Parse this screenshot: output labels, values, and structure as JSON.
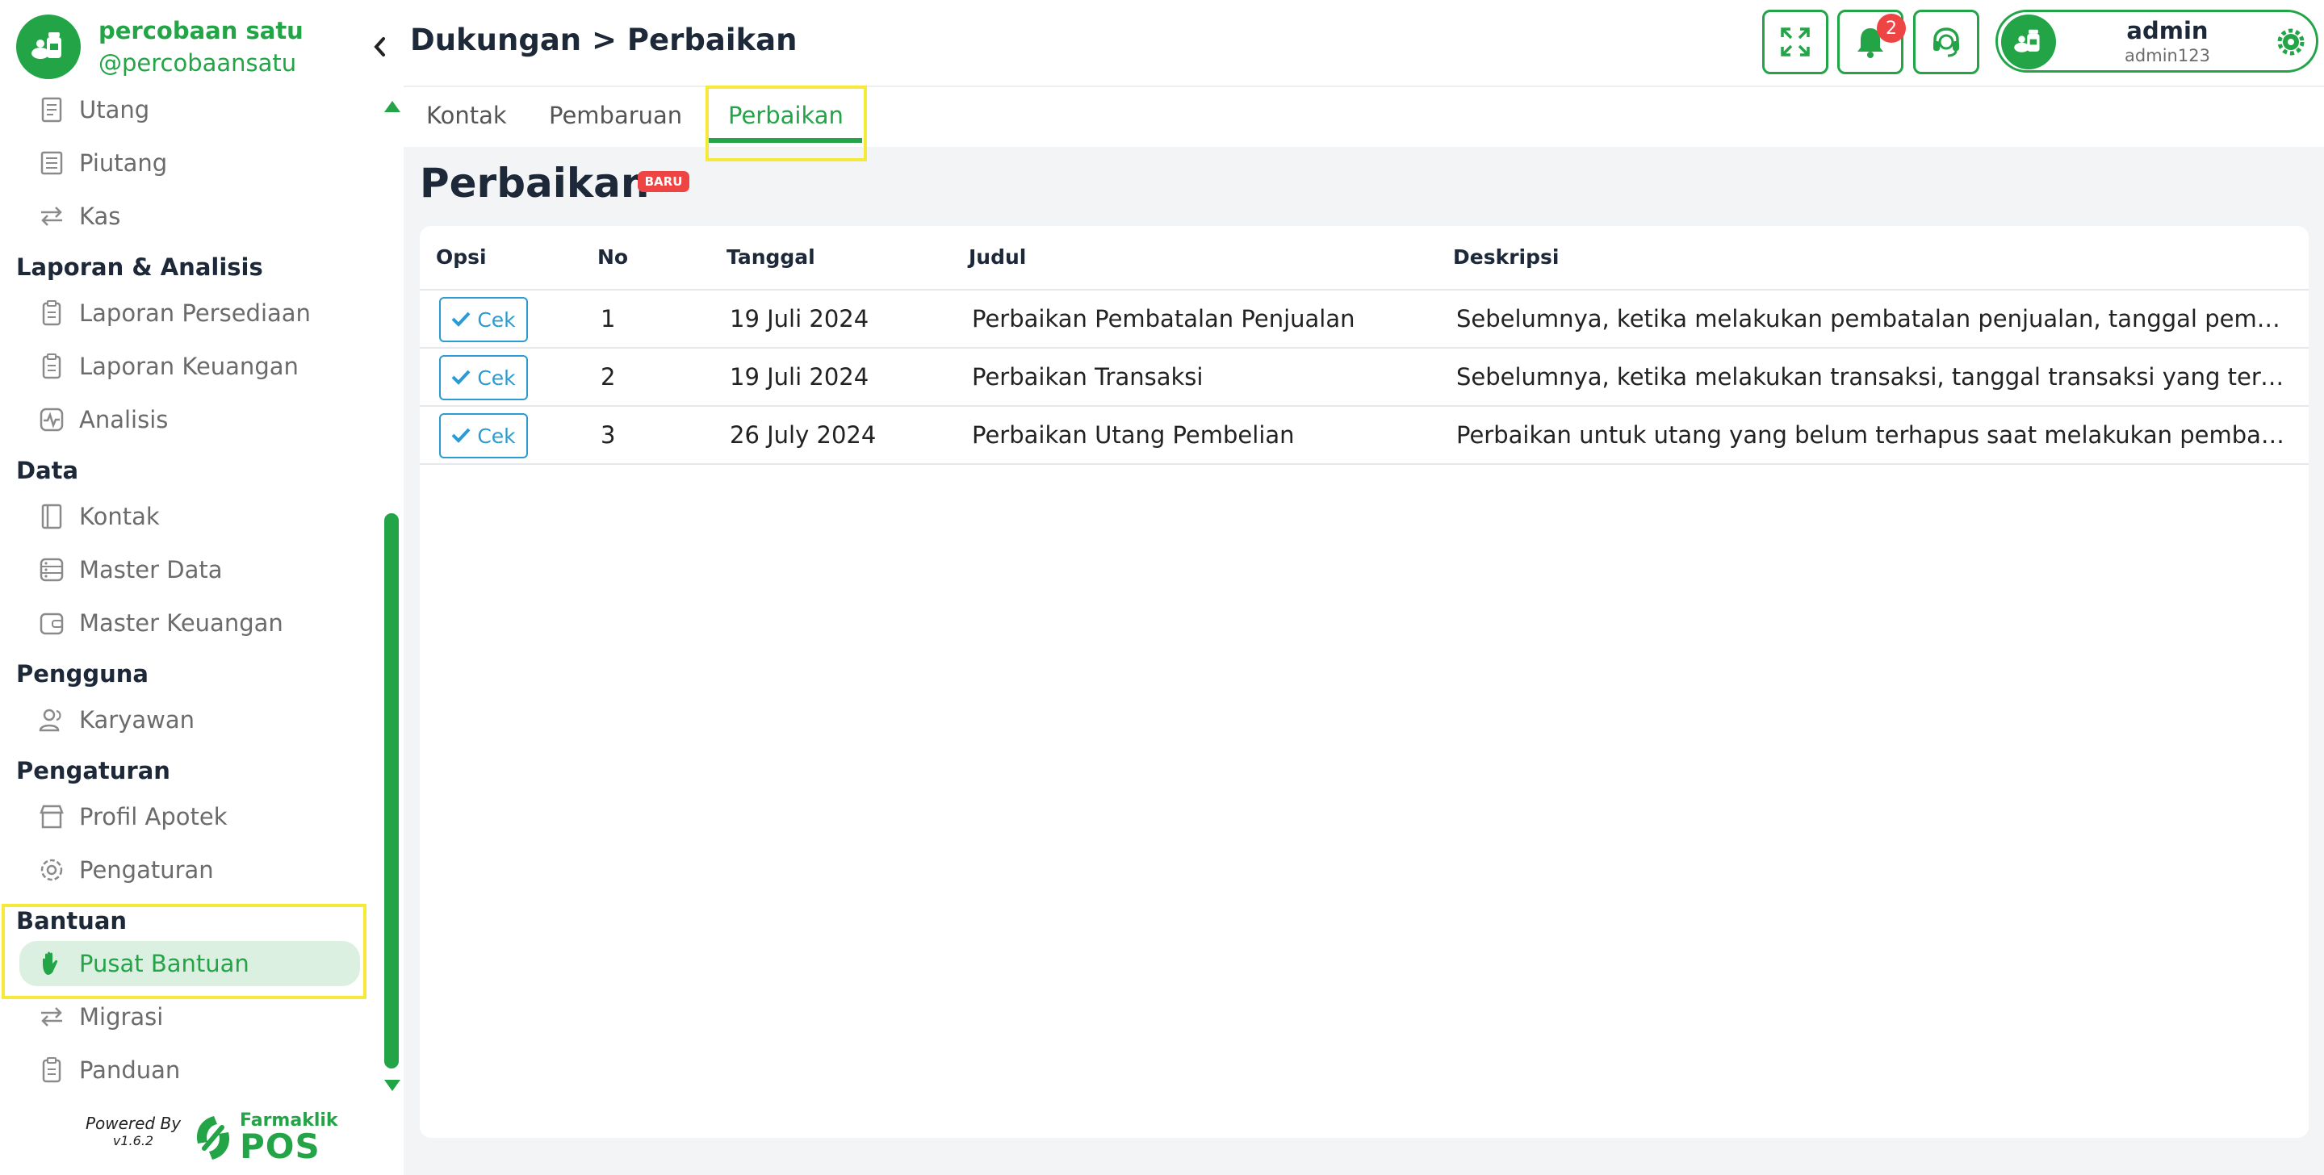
{
  "brand": {
    "name": "percobaan satu",
    "handle": "@percobaansatu"
  },
  "sidebar": {
    "items": [
      {
        "label": "Utang"
      },
      {
        "label": "Piutang"
      },
      {
        "label": "Kas"
      },
      {
        "label": "Laporan Persediaan"
      },
      {
        "label": "Laporan Keuangan"
      },
      {
        "label": "Analisis"
      },
      {
        "label": "Kontak"
      },
      {
        "label": "Master Data"
      },
      {
        "label": "Master Keuangan"
      },
      {
        "label": "Karyawan"
      },
      {
        "label": "Profil Apotek"
      },
      {
        "label": "Pengaturan"
      },
      {
        "label": "Pusat Bantuan"
      },
      {
        "label": "Migrasi"
      },
      {
        "label": "Panduan"
      }
    ],
    "sections": [
      "Laporan & Analisis",
      "Data",
      "Pengguna",
      "Pengaturan",
      "Bantuan"
    ]
  },
  "footer": {
    "powered_by": "Powered By",
    "version": "v1.6.2",
    "logo_top": "Farmaklik",
    "logo_bottom": "POS"
  },
  "header": {
    "breadcrumb": "Dukungan > Perbaikan",
    "notification_count": "2",
    "user_name": "admin",
    "user_handle": "admin123"
  },
  "tabs": [
    {
      "label": "Kontak"
    },
    {
      "label": "Pembaruan"
    },
    {
      "label": "Perbaikan",
      "active": true
    }
  ],
  "main": {
    "title": "Perbaikan",
    "badge": "BARU",
    "columns": [
      "Opsi",
      "No",
      "Tanggal",
      "Judul",
      "Deskripsi"
    ],
    "button_label": "Cek",
    "rows": [
      {
        "no": "1",
        "tanggal": "19 Juli 2024",
        "judul": "Perbaikan Pembatalan Penjualan",
        "deskripsi": "Sebelumnya, ketika melakukan pembatalan penjualan, tanggal pembatalan tercatat tidak sesuai"
      },
      {
        "no": "2",
        "tanggal": "19 Juli 2024",
        "judul": "Perbaikan Transaksi",
        "deskripsi": "Sebelumnya, ketika melakukan transaksi, tanggal transaksi yang tercatat tidak sesuai"
      },
      {
        "no": "3",
        "tanggal": "26 July 2024",
        "judul": "Perbaikan Utang Pembelian",
        "deskripsi": "Perbaikan untuk utang yang belum terhapus saat melakukan pembatalan pembelian"
      }
    ]
  },
  "colors": {
    "accent": "#22a447",
    "highlight": "#f5e93a",
    "badge": "#ef4444",
    "button": "#2b9bd1"
  }
}
